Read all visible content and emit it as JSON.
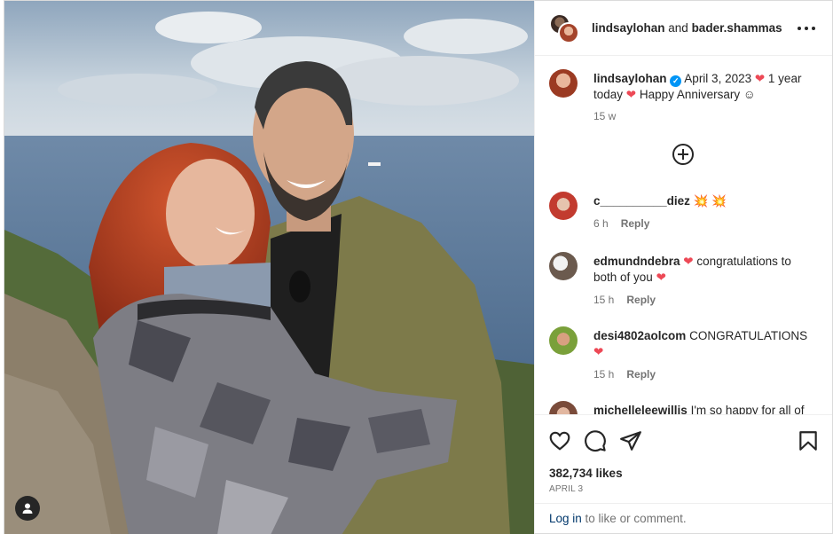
{
  "header": {
    "user1": "lindsaylohan",
    "joiner": " and ",
    "user2": "bader.shammas"
  },
  "caption": {
    "username": "lindsaylohan",
    "text_part1": " April 3, 2023 ",
    "text_part2": " 1 year today ",
    "text_part3": " Happy Anniversary ☺",
    "time": "15 w"
  },
  "comments": [
    {
      "username": "c__________diez",
      "text": " 💥 💥",
      "time": "6 h",
      "reply": "Reply"
    },
    {
      "username": "edmundndebra",
      "text_part1": " ",
      "text_part2": " congratulations to both of you ",
      "time": "15 h",
      "reply": "Reply"
    },
    {
      "username": "desi4802aolcom",
      "text_part1": " CONGRATULATIONS ",
      "time": "15 h",
      "reply": "Reply"
    },
    {
      "username": "michelleleewillis",
      "text": " I'm so happy for all of"
    }
  ],
  "actions": {
    "like_icon": "heart-outline-icon",
    "comment_icon": "comment-bubble-icon",
    "share_icon": "paper-plane-icon",
    "save_icon": "bookmark-icon"
  },
  "likes": "382,734 likes",
  "date": "APRIL 3",
  "login": {
    "link": "Log in",
    "text": " to like or comment."
  },
  "colors": {
    "heart": "#ed4956",
    "link": "#00376b",
    "verified": "#0095f6"
  }
}
